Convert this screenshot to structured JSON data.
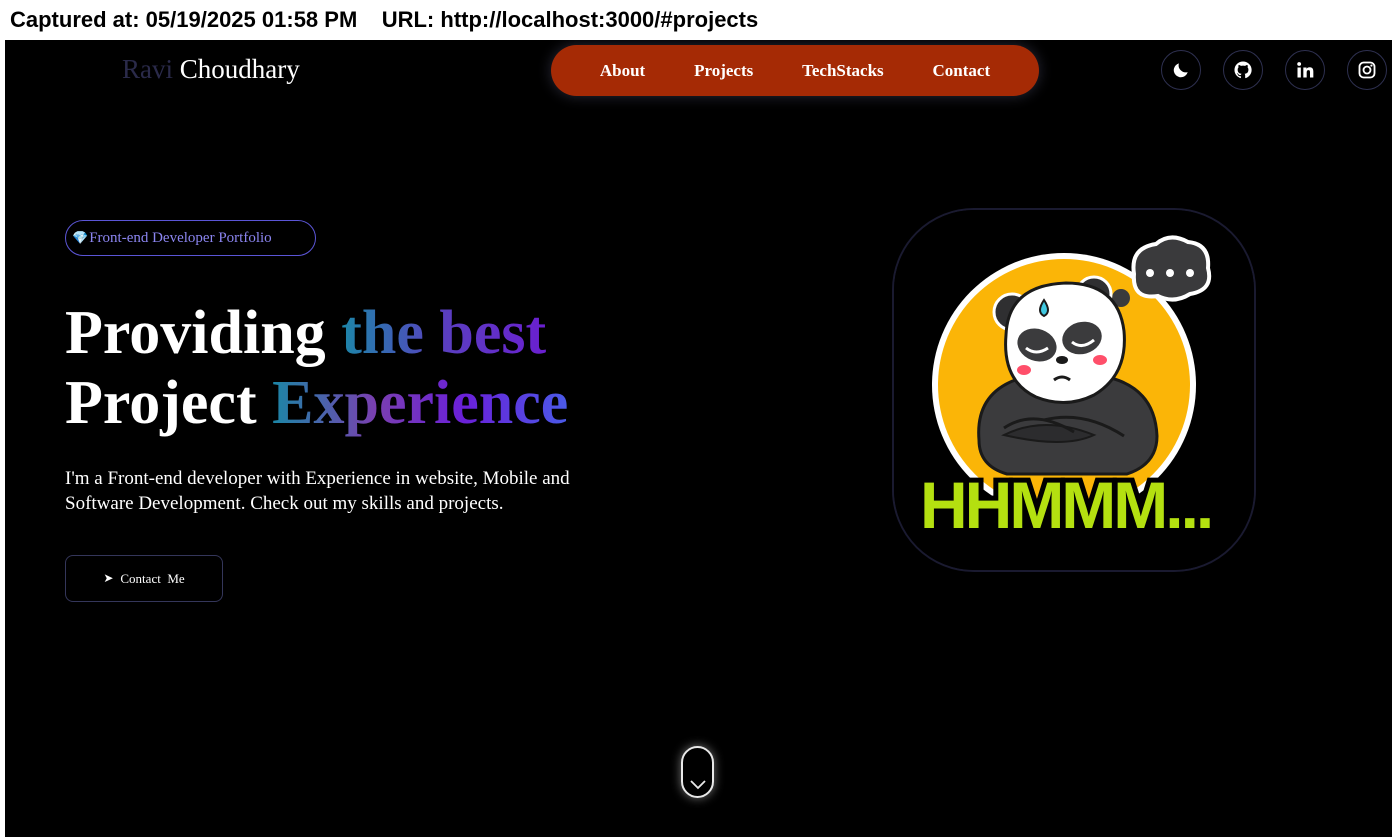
{
  "capture": {
    "text": "Captured at: 05/19/2025 01:58 PM    URL: http://localhost:3000/#projects"
  },
  "header": {
    "logo_first": "Ravi",
    "logo_last": "Choudhary",
    "nav": [
      {
        "label": "About"
      },
      {
        "label": "Projects"
      },
      {
        "label": "TechStacks"
      },
      {
        "label": "Contact"
      }
    ],
    "icons": [
      "moon-icon",
      "github-icon",
      "linkedin-icon",
      "instagram-icon"
    ]
  },
  "hero": {
    "badge_text": "Front-end Developer Portfolio",
    "headline": {
      "line1_plain": "Providing ",
      "line1_grad": "the best",
      "line2_plain": "Project ",
      "line2_grad": "Experience"
    },
    "description": "I'm a Front-end developer with Experience in website, Mobile and Software Development. Check out my skills and projects.",
    "contact_label": "Contact  Me"
  },
  "illustration": {
    "sticker_text": "HHMMM..."
  },
  "colors": {
    "background": "#000000",
    "nav_pill": "#a52a05",
    "badge": "#8b85f0",
    "sticker_orange": "#fbb507",
    "sticker_green": "#b4e010"
  }
}
